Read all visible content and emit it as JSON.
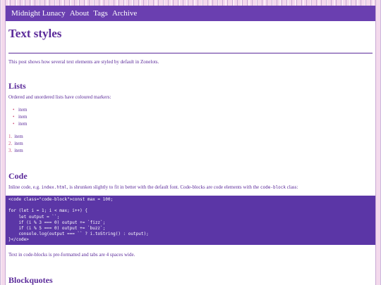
{
  "nav": {
    "site_title": "Midnight Lunacy",
    "about": "About",
    "tags": "Tags",
    "archive": "Archive"
  },
  "post": {
    "title": "Text styles",
    "intro": "This post shows how several text elements are styled by default in Zonelots.",
    "lists": {
      "heading": "Lists",
      "intro": "Ordered and unordered lists have coloured markers:",
      "unordered": [
        "item",
        "item",
        "item"
      ],
      "ordered": [
        "item",
        "item",
        "item"
      ]
    },
    "code": {
      "heading": "Code",
      "intro_before": "Inline code, e.g. ",
      "inline_example": "index.html",
      "intro_middle": ", is shrunken slightly to fit in better with the default font. Code-blocks are code elements with the ",
      "class_example": "code-block",
      "intro_after": " class:",
      "block": "<code class=\"code-block\">const max = 100;\n\nfor (let i = 1; i < max; i++) {\n    let output = ``;\n    if (i % 3 === 0) output += `fizz`;\n    if (i % 5 === 0) output += `buzz`;\n    console.log(output === `` ? i.toString() : output);\n}</code>",
      "after": "Text in code-blocks is pre-formatted and tabs are 4 spaces wide."
    },
    "blockquotes": {
      "heading": "Blockquotes"
    }
  },
  "colors": {
    "background": "#f3d9ec",
    "accent": "#6a3fb0",
    "text": "#5b2a9a",
    "marker": "#d04f7a",
    "code_bg": "#5b36a6"
  }
}
